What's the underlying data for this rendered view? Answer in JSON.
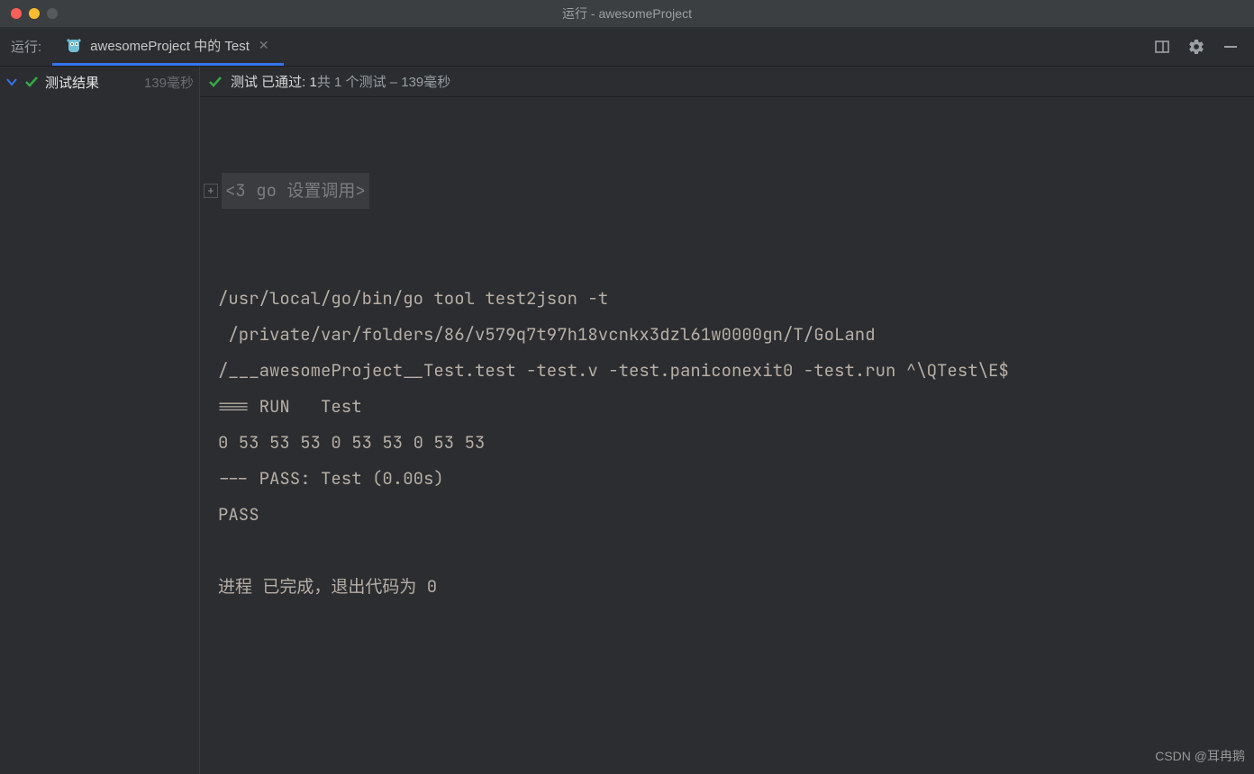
{
  "titlebar": {
    "title": "运行 - awesomeProject"
  },
  "tabbar": {
    "run_label": "运行:",
    "tab_label": "awesomeProject 中的 Test"
  },
  "left": {
    "result_label": "测试结果",
    "result_time": "139毫秒"
  },
  "status": {
    "prefix": "测试 已通过: 1",
    "mid": "共 1 个测试",
    "suffix": " – 139毫秒"
  },
  "console": {
    "fold": "<3 go 设置调用>",
    "lines": [
      "/usr/local/go/bin/go tool test2json -t",
      " /private/var/folders/86/v579q7t97h18vcnkx3dzl61w0000gn/T/GoLand",
      "/___awesomeProject__Test.test -test.v -test.paniconexit0 -test.run ^\\QTest\\E$",
      "=== RUN   Test",
      "0 53 53 53 0 53 53 0 53 53",
      "--- PASS: Test (0.00s)",
      "PASS",
      "",
      "进程 已完成，退出代码为 0"
    ]
  },
  "watermark": "CSDN @耳冉鹅"
}
